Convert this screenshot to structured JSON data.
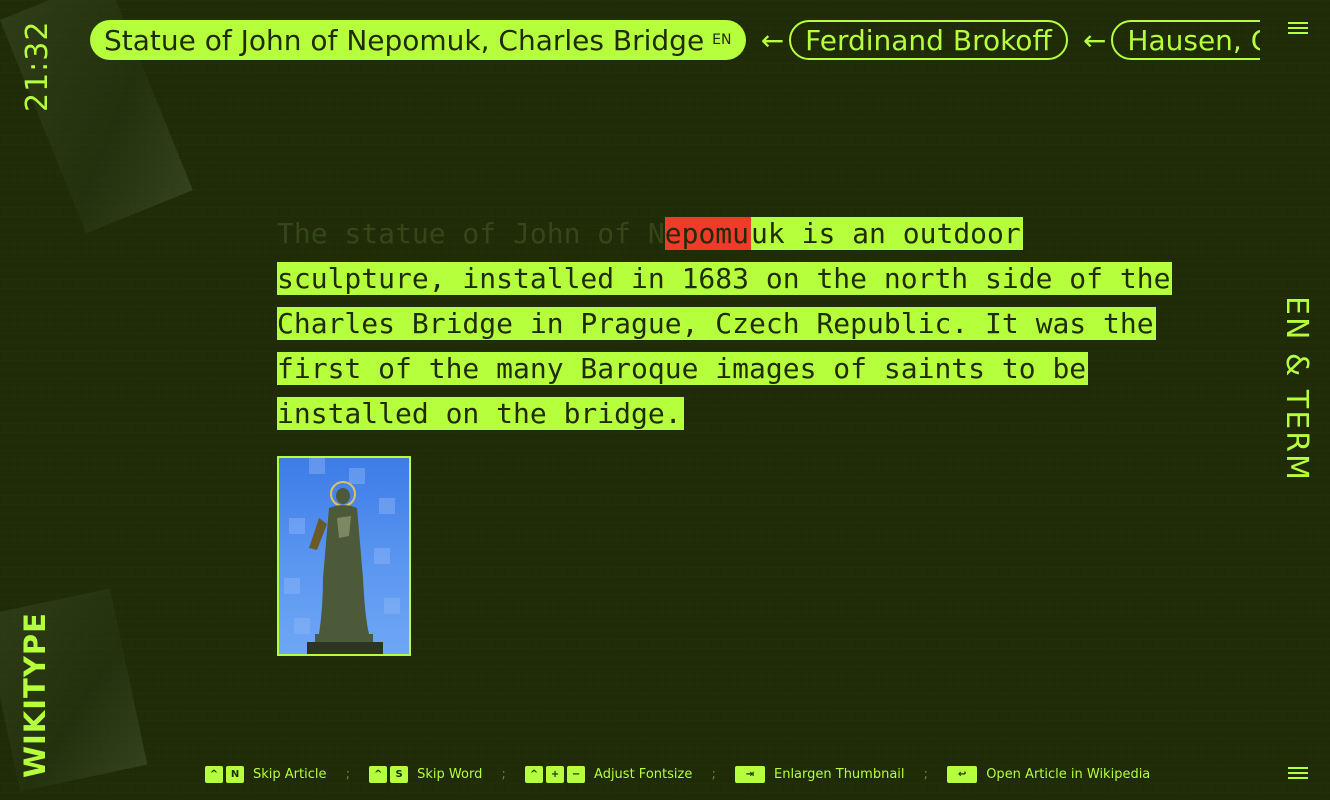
{
  "clock": "21:32",
  "brand": "WIKITYPE",
  "mode_label": "EN & TERM",
  "breadcrumbs": {
    "current": {
      "title": "Statue of John of Nepomuk, Charles Bridge",
      "lang": "EN"
    },
    "previous": [
      {
        "title": "Ferdinand Brokoff"
      },
      {
        "title": "Hausen, C"
      }
    ],
    "arrow_glyph": "←"
  },
  "article": {
    "typed": "The statue of John of N",
    "cursor": "epomu",
    "remaining": "uk is an outdoor sculpture, installed in 1683 on the north side of the Charles Bridge in Prague, Czech Republic. It was the first of the many Baroque images of saints to be installed on the bridge."
  },
  "thumbnail": {
    "icon": "statue-image"
  },
  "shortcuts": [
    {
      "keys": [
        "^",
        "N"
      ],
      "label": "Skip Article"
    },
    {
      "keys": [
        "^",
        "S"
      ],
      "label": "Skip Word"
    },
    {
      "keys": [
        "^",
        "+",
        "−"
      ],
      "label": "Adjust Fontsize"
    },
    {
      "keys": [
        "⇥"
      ],
      "label": "Enlargen Thumbnail"
    },
    {
      "keys": [
        "↩"
      ],
      "label": "Open Article in Wikipedia"
    }
  ],
  "separator": ";",
  "colors": {
    "background": "#1f2c07",
    "accent": "#b6ff3c",
    "cursor": "#f03a2a"
  }
}
